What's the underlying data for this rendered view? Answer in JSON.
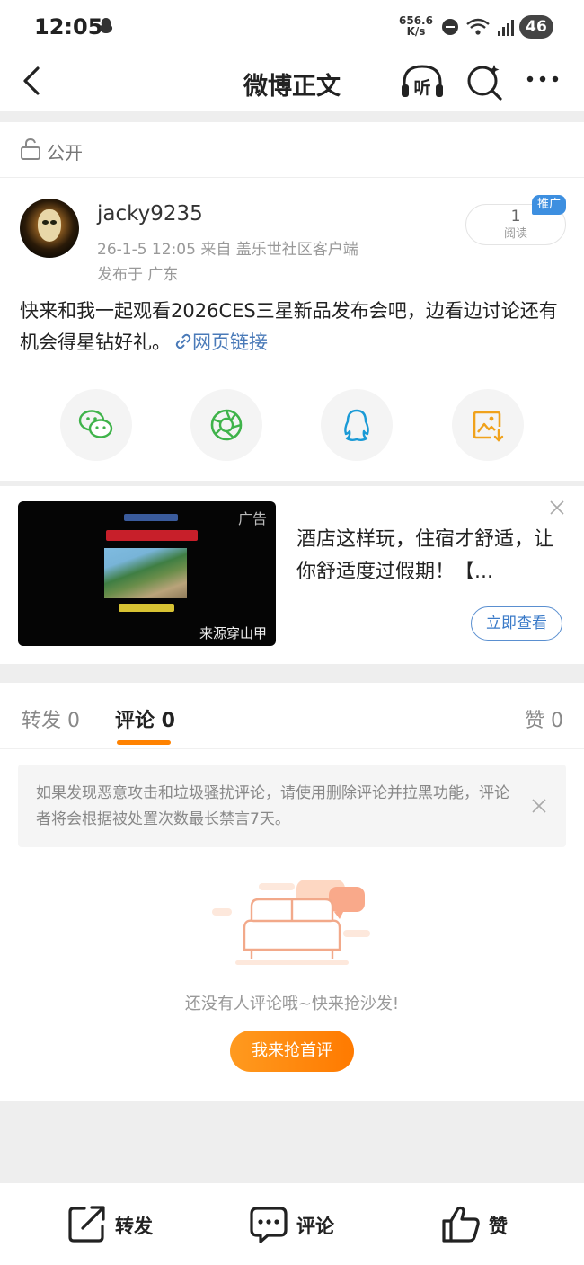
{
  "status_bar": {
    "time": "12:05",
    "net_speed_value": "656.6",
    "net_speed_unit": "K/s",
    "battery": "46",
    "icons": [
      "app-notification-icon",
      "dnd-icon",
      "wifi-icon",
      "signal-5g-icon",
      "battery-icon"
    ]
  },
  "nav": {
    "title": "微博正文",
    "listen_icon_text": "听",
    "icons": [
      "back-icon",
      "listen-icon",
      "search-icon",
      "more-icon"
    ]
  },
  "visibility": {
    "label": "公开"
  },
  "post": {
    "username": "jacky9235",
    "meta": "26-1-5 12:05   来自 盖乐世社区客户端",
    "location": "发布于 广东",
    "read_count": "1",
    "read_label": "阅读",
    "promo_badge": "推广",
    "text": "快来和我一起观看2026CES三星新品发布会吧，边看边讨论还有机会得星钻好礼。",
    "link_text": "网页链接",
    "share_icons": [
      "wechat-icon",
      "moments-icon",
      "qq-icon",
      "save-image-icon"
    ]
  },
  "ad": {
    "label": "广告",
    "source": "来源穿山甲",
    "text": "酒店这样玩，住宿才舒适，让你舒适度过假期！【...",
    "button": "立即查看"
  },
  "tabs": {
    "repost": "转发 0",
    "comment": "评论 0",
    "like": "赞 0"
  },
  "comments": {
    "notice": "如果发现恶意攻击和垃圾骚扰评论，请使用删除评论并拉黑功能，评论者将会根据被处置次数最长禁言7天。",
    "empty_text": "还没有人评论哦~快来抢沙发!",
    "first_comment_button": "我来抢首评"
  },
  "toolbar": {
    "repost": "转发",
    "comment": "评论",
    "like": "赞"
  },
  "colors": {
    "accent": "#ff8200",
    "link": "#4a7ab8",
    "promo": "#3d8fe0"
  }
}
